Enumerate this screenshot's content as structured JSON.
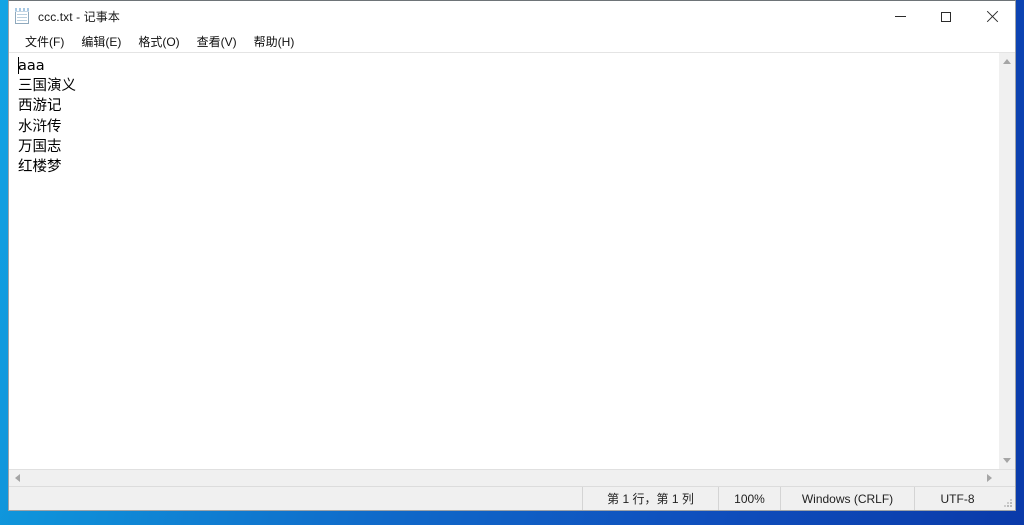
{
  "window": {
    "title": "ccc.txt - 记事本",
    "app_icon": "notepad-icon",
    "controls": {
      "minimize": "minimize-icon",
      "maximize": "maximize-icon",
      "close": "close-icon"
    }
  },
  "menubar": {
    "items": [
      {
        "label": "文件(F)"
      },
      {
        "label": "编辑(E)"
      },
      {
        "label": "格式(O)"
      },
      {
        "label": "查看(V)"
      },
      {
        "label": "帮助(H)"
      }
    ]
  },
  "editor": {
    "lines": [
      "aaa",
      "三国演义",
      "西游记",
      "水浒传",
      "万国志",
      "红楼梦"
    ]
  },
  "scrollbars": {
    "vertical": {
      "up_arrow": "chevron-up-icon",
      "down_arrow": "chevron-down-icon"
    },
    "horizontal": {
      "left_arrow": "chevron-left-icon",
      "right_arrow": "chevron-right-icon"
    }
  },
  "statusbar": {
    "position": "第 1 行，第 1 列",
    "zoom": "100%",
    "line_ending": "Windows (CRLF)",
    "encoding": "UTF-8",
    "resize_grip": "resize-grip-icon"
  },
  "colors": {
    "desktop_blue": "#0f62c8",
    "window_bg": "#ffffff",
    "chrome_gray": "#f0f0f0",
    "text": "#000000"
  }
}
